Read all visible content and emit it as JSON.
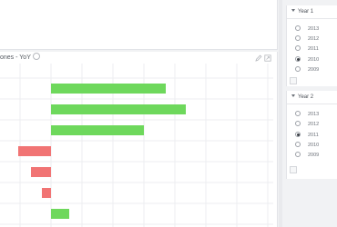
{
  "chart": {
    "title": "ones - YoY",
    "colors": {
      "positive": "#6ed85c",
      "negative": "#f17474",
      "grid": "#eceef1"
    }
  },
  "chart_data": {
    "type": "bar",
    "orientation": "horizontal",
    "bars": [
      {
        "start": 0,
        "end": 126
      },
      {
        "start": 0,
        "end": 148
      },
      {
        "start": 0,
        "end": 102
      },
      {
        "start": -36,
        "end": 0
      },
      {
        "start": -22,
        "end": 0
      },
      {
        "start": -10,
        "end": 0
      },
      {
        "start": 0,
        "end": 20
      }
    ]
  },
  "filters": [
    {
      "title": "Year 1",
      "options": [
        "2013",
        "2012",
        "2011",
        "2010",
        "2009"
      ],
      "selected": "2010"
    },
    {
      "title": "Year 2",
      "options": [
        "2013",
        "2012",
        "2011",
        "2010",
        "2009"
      ],
      "selected": "2011"
    }
  ]
}
